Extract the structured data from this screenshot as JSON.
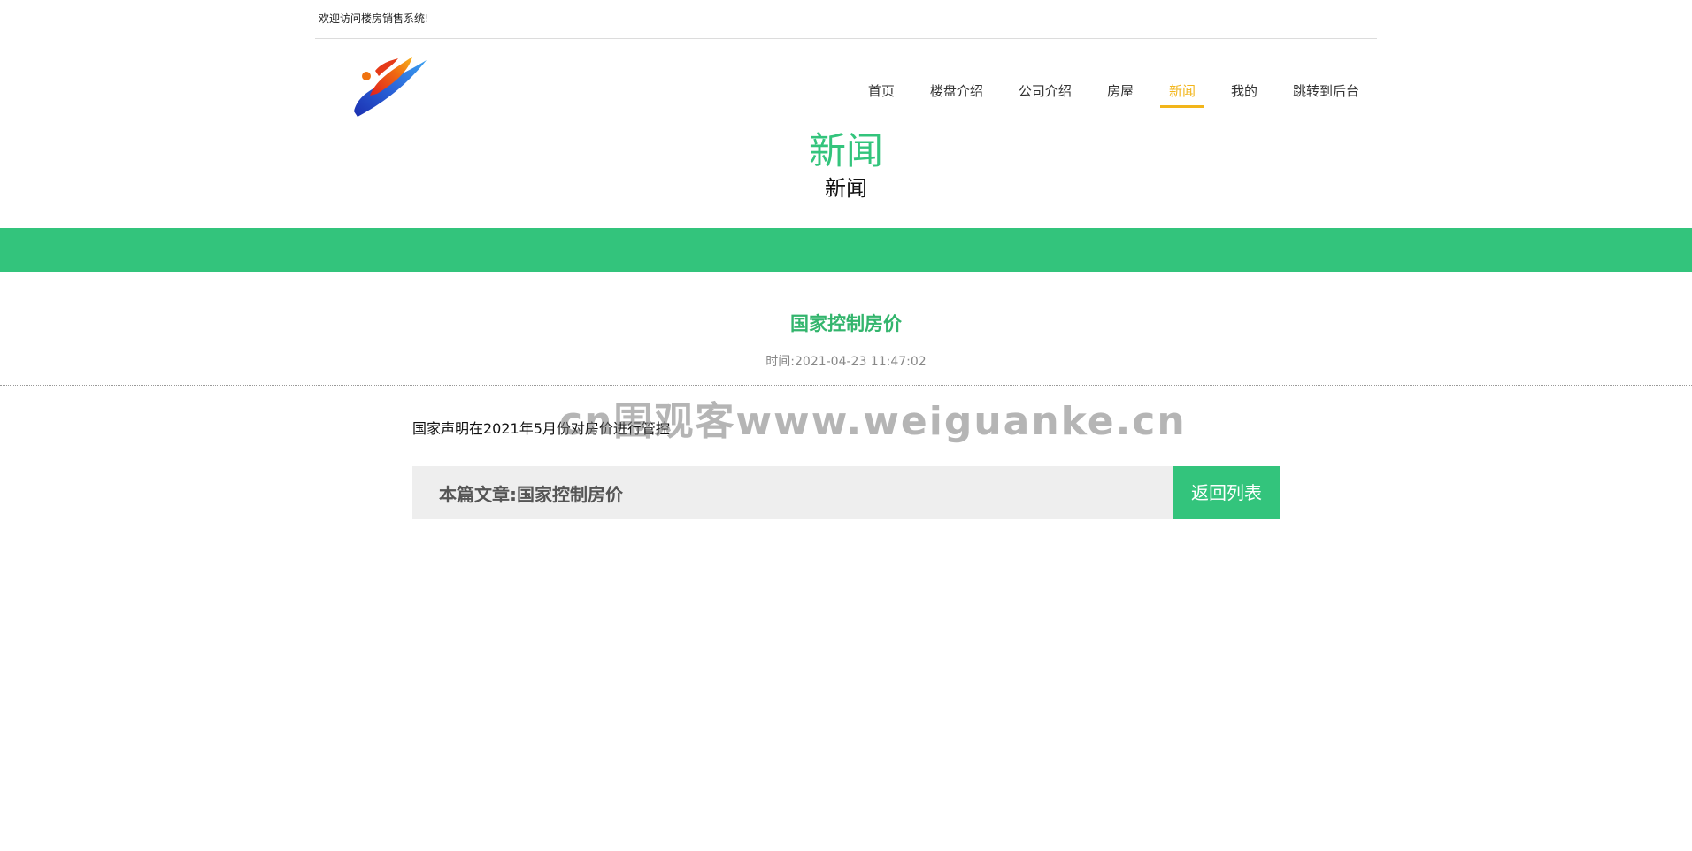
{
  "header": {
    "welcome_text": "欢迎访问楼房销售系统!",
    "logo_icon": "swirl-logo-icon"
  },
  "nav": {
    "items": [
      {
        "label": "首页",
        "active": false
      },
      {
        "label": "楼盘介绍",
        "active": false
      },
      {
        "label": "公司介绍",
        "active": false
      },
      {
        "label": "房屋",
        "active": false
      },
      {
        "label": "新闻",
        "active": true
      },
      {
        "label": "我的",
        "active": false
      },
      {
        "label": "跳转到后台",
        "active": false
      }
    ],
    "active_color": "#f2b51a"
  },
  "section": {
    "title": "新闻",
    "subtitle": "新闻"
  },
  "article": {
    "title": "国家控制房价",
    "time_label": "时间:",
    "time_value": "2021-04-23 11:47:02",
    "body": "国家声明在2021年5月份对房价进行管控"
  },
  "footer": {
    "label_prefix": "本篇文章:",
    "label_title": "国家控制房价",
    "back_label": "返回列表"
  },
  "watermark": "cn围观客www.weiguanke.cn",
  "colors": {
    "accent_green": "#33c47c",
    "nav_active": "#f2b51a"
  }
}
